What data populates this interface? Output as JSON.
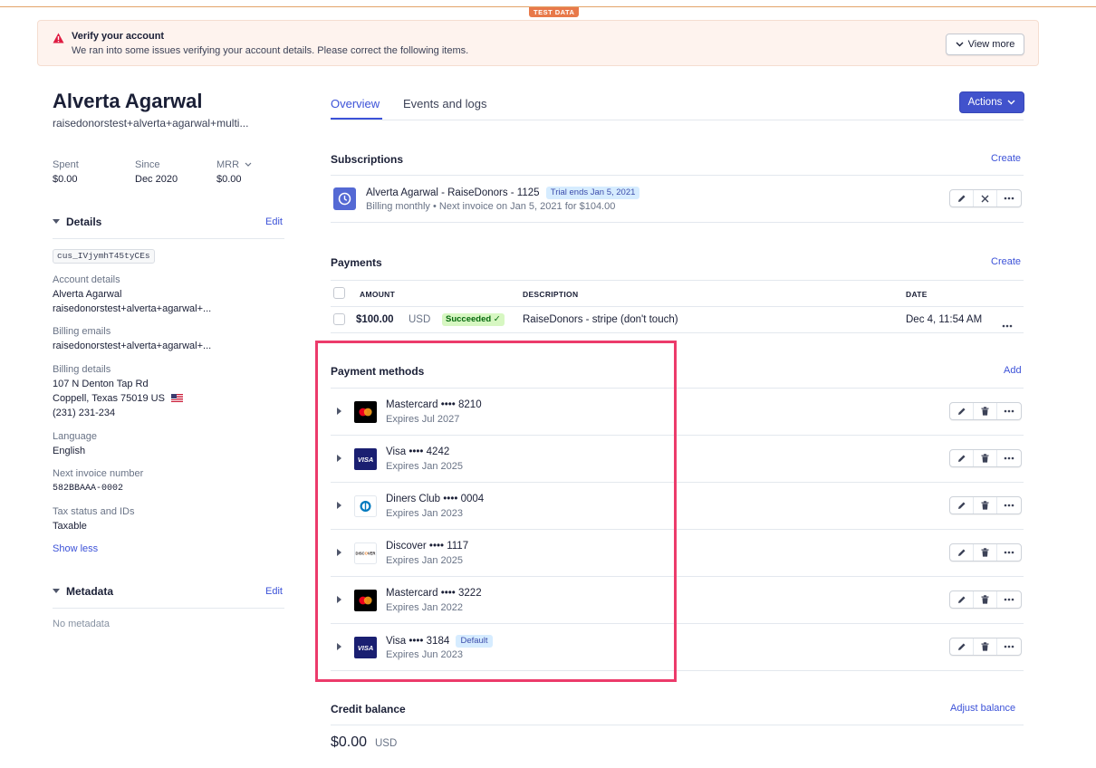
{
  "test_badge": "TEST DATA",
  "banner": {
    "title": "Verify your account",
    "description": "We ran into some issues verifying your account details. Please correct the following items.",
    "view_more": "View more"
  },
  "customer": {
    "name": "Alverta Agarwal",
    "email": "raisedonorstest+alverta+agarwal+multi..."
  },
  "stats": [
    {
      "label": "Spent",
      "value": "$0.00"
    },
    {
      "label": "Since",
      "value": "Dec 2020"
    },
    {
      "label": "MRR",
      "value": "$0.00"
    }
  ],
  "details": {
    "heading": "Details",
    "edit": "Edit",
    "customer_id": "cus_IVjymhT45tyCEs",
    "account_label": "Account details",
    "account_name": "Alverta Agarwal",
    "account_email": "raisedonorstest+alverta+agarwal+...",
    "billing_emails_label": "Billing emails",
    "billing_emails": "raisedonorstest+alverta+agarwal+...",
    "billing_details_label": "Billing details",
    "address_1": "107 N Denton Tap Rd",
    "address_2": "Coppell, Texas 75019 US",
    "phone": "(231) 231-234",
    "language_label": "Language",
    "language": "English",
    "next_invoice_label": "Next invoice number",
    "next_invoice": "582BBAAA-0002",
    "tax_label": "Tax status and IDs",
    "tax": "Taxable",
    "show_less": "Show less"
  },
  "metadata": {
    "heading": "Metadata",
    "edit": "Edit",
    "empty": "No metadata"
  },
  "tabs": [
    {
      "label": "Overview"
    },
    {
      "label": "Events and logs"
    }
  ],
  "actions_button": "Actions",
  "subscriptions": {
    "heading": "Subscriptions",
    "create": "Create",
    "item": {
      "title": "Alverta Agarwal - RaiseDonors - 1125",
      "badge": "Trial ends Jan 5, 2021",
      "subtitle": "Billing monthly • Next invoice on Jan 5, 2021 for $104.00"
    }
  },
  "payments": {
    "heading": "Payments",
    "create": "Create",
    "columns": [
      "AMOUNT",
      "DESCRIPTION",
      "DATE"
    ],
    "rows": [
      {
        "amount": "$100.00",
        "currency": "USD",
        "status": "Succeeded ✓",
        "description": "RaiseDonors - stripe (don't touch)",
        "date": "Dec 4, 11:54 AM"
      }
    ]
  },
  "payment_methods": {
    "heading": "Payment methods",
    "add": "Add",
    "items": [
      {
        "title": "Mastercard •••• 8210",
        "expires": "Expires Jul 2027",
        "brand": "mastercard"
      },
      {
        "title": "Visa •••• 4242",
        "expires": "Expires Jan 2025",
        "brand": "visa"
      },
      {
        "title": "Diners Club •••• 0004",
        "expires": "Expires Jan 2023",
        "brand": "diners"
      },
      {
        "title": "Discover •••• 1117",
        "expires": "Expires Jan 2025",
        "brand": "discover"
      },
      {
        "title": "Mastercard •••• 3222",
        "expires": "Expires Jan 2022",
        "brand": "mastercard"
      },
      {
        "title": "Visa •••• 3184",
        "expires": "Expires Jun 2023",
        "brand": "visa",
        "badge": "Default"
      }
    ]
  },
  "credit_balance": {
    "heading": "Credit balance",
    "adjust": "Adjust balance",
    "amount": "$0.00",
    "currency": "USD"
  },
  "colors": {
    "accent": "#3c52d8",
    "highlight": "#ec3b6b",
    "banner_bg": "#fef3ee"
  }
}
